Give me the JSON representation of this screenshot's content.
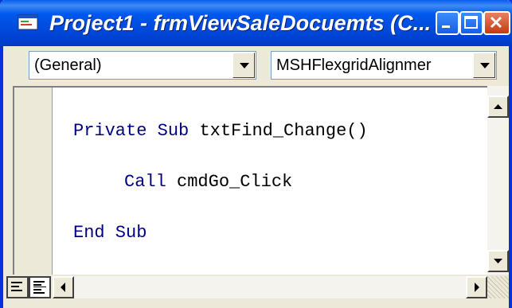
{
  "window": {
    "title": "Project1 - frmViewSaleDocuemts (C...",
    "controls": [
      "minimize-icon",
      "maximize-icon",
      "close-icon"
    ]
  },
  "toolbar": {
    "object_combo": {
      "value": "(General)"
    },
    "procedure_combo": {
      "value": "MSHFlexgridAlignmer"
    }
  },
  "code": {
    "lines": [
      {
        "keyword": "Private Sub ",
        "ident": "txtFind_Change()"
      },
      {
        "keyword": "Call ",
        "ident": "cmdGo_Click"
      },
      {
        "keyword": "End Sub",
        "ident": ""
      }
    ]
  },
  "colors": {
    "titlebar": "#0054e3",
    "keyword": "#000080",
    "window_bg": "#ece9d8"
  }
}
